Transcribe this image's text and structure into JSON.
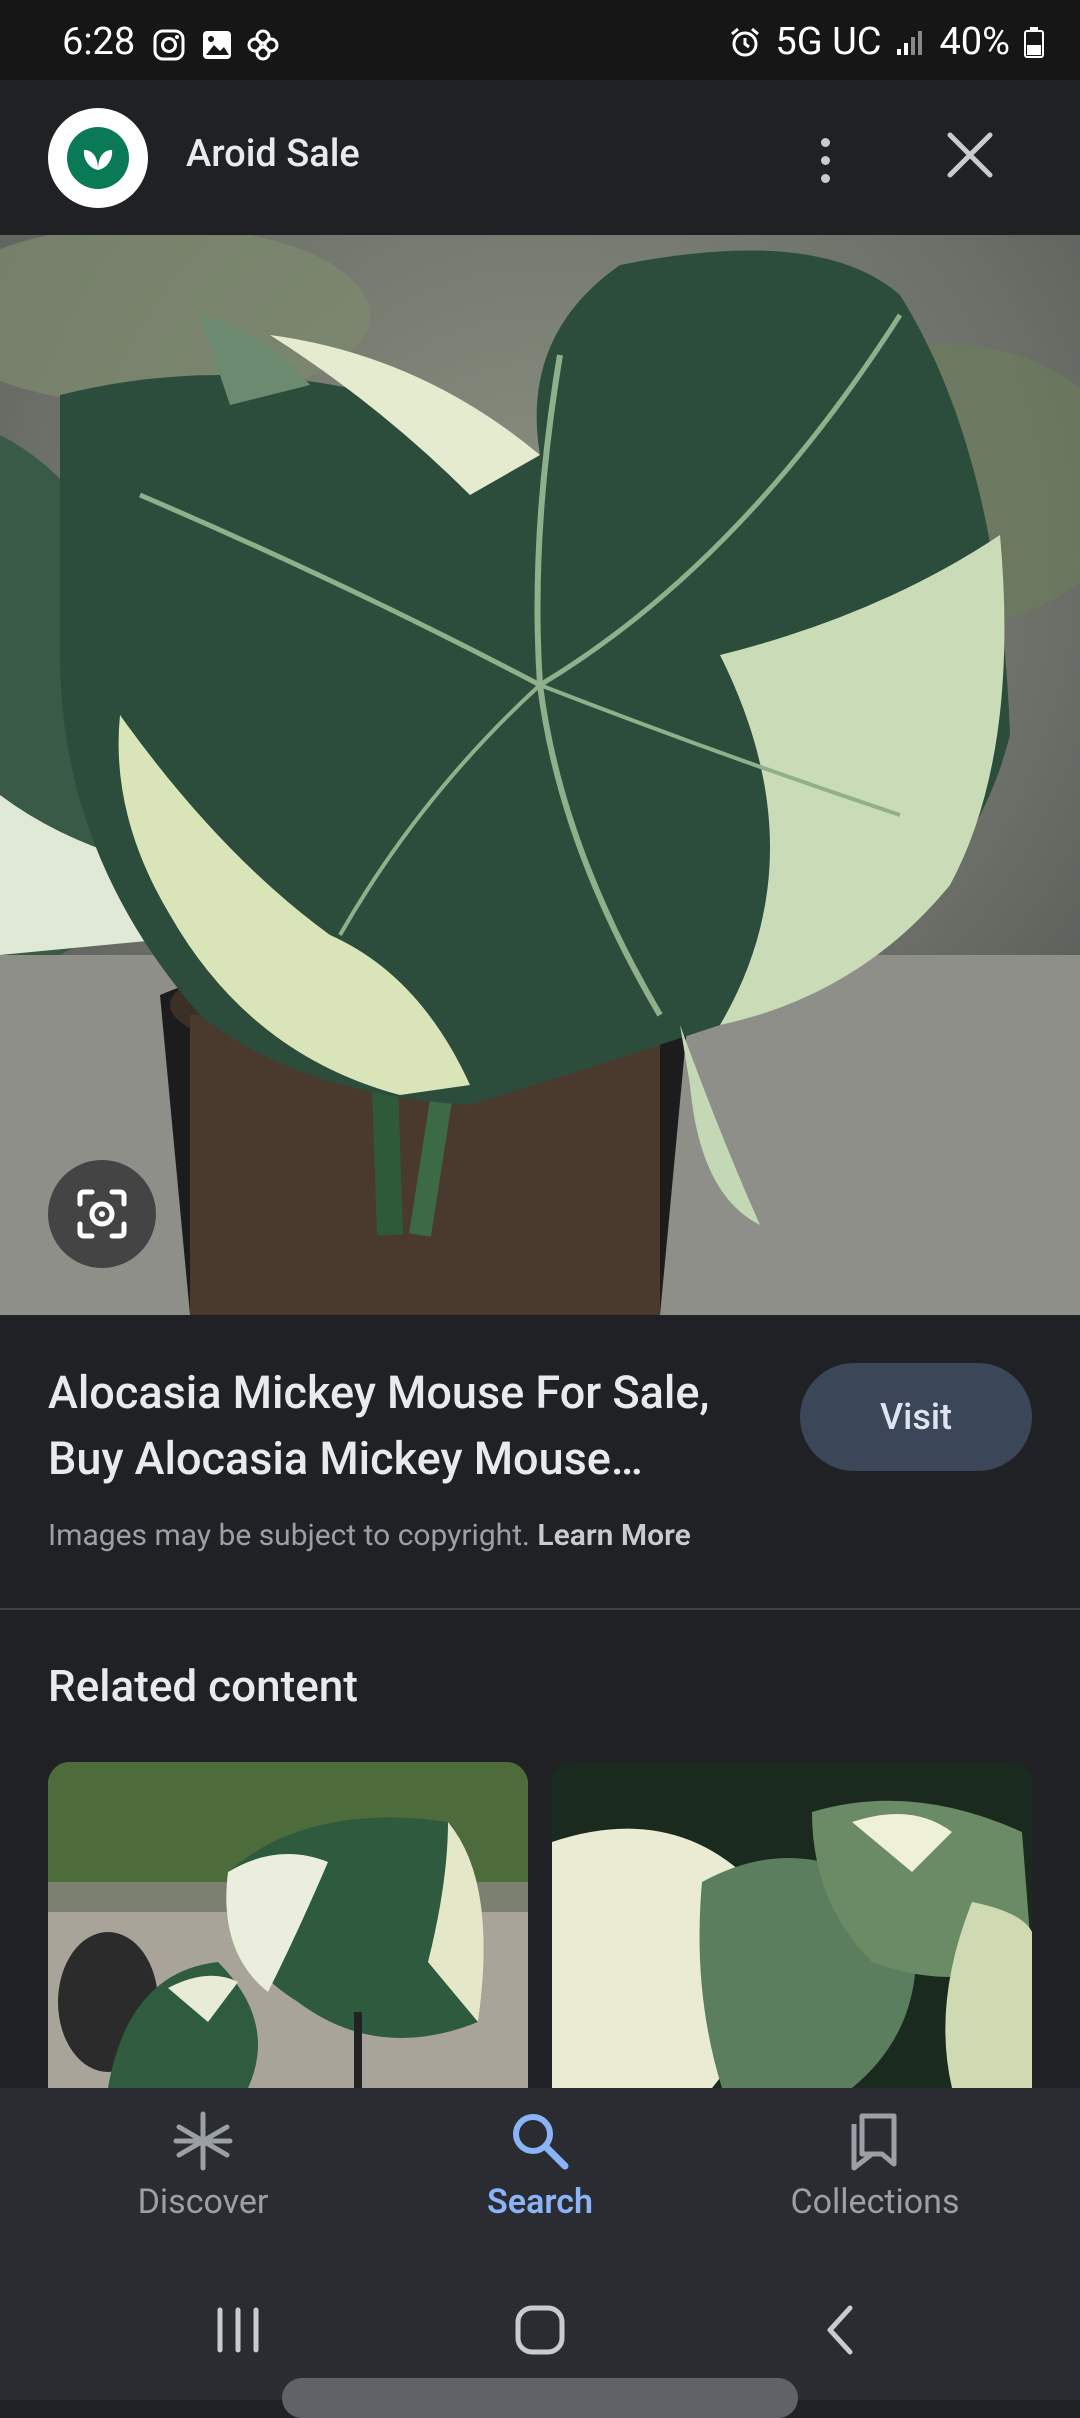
{
  "status_bar": {
    "time": "6:28",
    "network": "5G UC",
    "battery": "40%",
    "left_icons": [
      "instagram-icon",
      "gallery-icon",
      "pinwheel-icon"
    ],
    "right_icons": [
      "alarm-icon",
      "signal-icon",
      "battery-icon"
    ]
  },
  "header": {
    "site_name": "Aroid Sale",
    "logo_icon": "leaf-icon",
    "menu_icon": "more-vert-icon",
    "close_icon": "close-icon"
  },
  "result": {
    "title": "Alocasia Mickey Mouse For Sale, Buy Alocasia Mickey Mouse…",
    "visit_label": "Visit",
    "copyright_text": "Images may be subject to copyright.",
    "learn_more_label": "Learn More",
    "lens_icon": "lens-icon"
  },
  "related": {
    "heading": "Related content"
  },
  "bottom_nav": {
    "items": [
      {
        "label": "Discover",
        "icon": "asterisk-icon"
      },
      {
        "label": "Search",
        "icon": "search-icon"
      },
      {
        "label": "Collections",
        "icon": "bookmarks-icon"
      }
    ],
    "active": "Search"
  },
  "colors": {
    "background": "#202124",
    "accent": "#8ab4f8",
    "visit_button": "#3c4659",
    "logo_green": "#0a7a56"
  }
}
